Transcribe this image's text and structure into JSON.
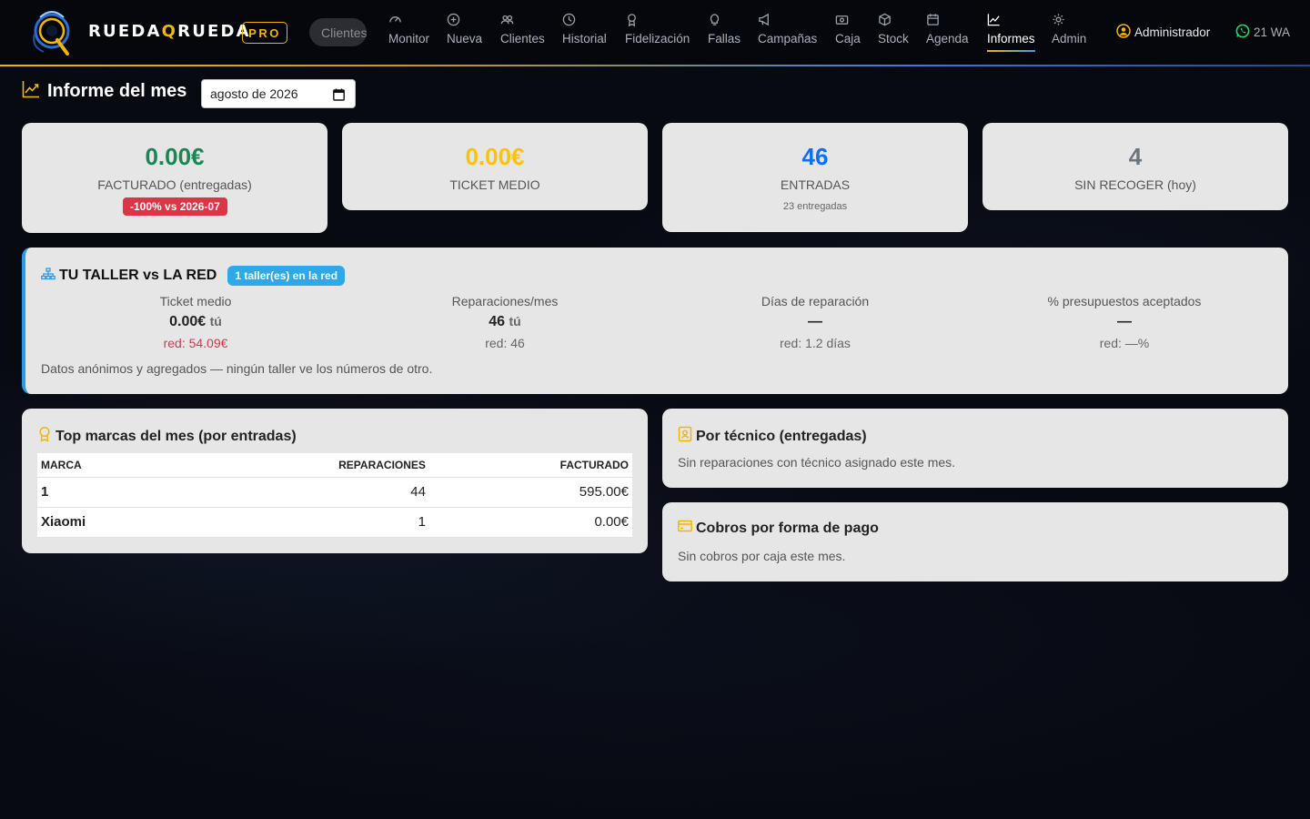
{
  "nav": {
    "brand_part1": "RUEDA",
    "brand_q": "Q",
    "brand_part2": "RUEDA",
    "pro_label": "PRO",
    "search_placeholder": "Clientes",
    "items": [
      {
        "label": "Monitor",
        "icon": "gauge-icon"
      },
      {
        "label": "Nueva",
        "icon": "plus-circle-icon"
      },
      {
        "label": "Clientes",
        "icon": "people-icon"
      },
      {
        "label": "Historial",
        "icon": "clock-icon"
      },
      {
        "label": "Fidelización",
        "icon": "award-icon"
      },
      {
        "label": "Fallas",
        "icon": "lightbulb-icon"
      },
      {
        "label": "Campañas",
        "icon": "megaphone-icon"
      },
      {
        "label": "Caja",
        "icon": "cash-icon"
      },
      {
        "label": "Stock",
        "icon": "box-icon"
      },
      {
        "label": "Agenda",
        "icon": "calendar-icon"
      },
      {
        "label": "Informes",
        "icon": "chart-icon",
        "active": true
      },
      {
        "label": "Admin",
        "icon": "gear-icon"
      }
    ],
    "user_label": "Administrador",
    "wa_label": "21 WA"
  },
  "page": {
    "title": "Informe del mes",
    "month_value": "agosto de 2026"
  },
  "stats": {
    "facturado": {
      "value": "0.00€",
      "label": "FACTURADO (entregadas)",
      "badge": "-100% vs 2026-07",
      "color": "#198754"
    },
    "ticket": {
      "value": "0.00€",
      "label": "TICKET MEDIO",
      "color": "#ffc107"
    },
    "entradas": {
      "value": "46",
      "label": "ENTRADAS",
      "sub": "23 entregadas",
      "color": "#0d6efd"
    },
    "sin_recoger": {
      "value": "4",
      "label": "SIN RECOGER (hoy)",
      "color": "#6c757d"
    }
  },
  "network": {
    "title": "TU TALLER vs LA RED",
    "badge": "1 taller(es) en la red",
    "you_suffix": "tú",
    "metrics": [
      {
        "label": "Ticket medio",
        "you": "0.00€",
        "red": "red: 54.09€",
        "bad": true
      },
      {
        "label": "Reparaciones/mes",
        "you": "46",
        "red": "red: 46",
        "bad": false
      },
      {
        "label": "Días de reparación",
        "you": "—",
        "red": "red: 1.2 días",
        "bad": false
      },
      {
        "label": "% presupuestos aceptados",
        "you": "—",
        "red": "red: —%",
        "bad": false
      }
    ],
    "footer": "Datos anónimos y agregados — ningún taller ve los números de otro."
  },
  "brands": {
    "title": "Top marcas del mes (por entradas)",
    "columns": [
      "MARCA",
      "REPARACIONES",
      "FACTURADO"
    ],
    "rows": [
      [
        "1",
        "44",
        "595.00€"
      ],
      [
        "Xiaomi",
        "1",
        "0.00€"
      ]
    ]
  },
  "tecnico": {
    "title": "Por técnico (entregadas)",
    "empty": "Sin reparaciones con técnico asignado este mes."
  },
  "cobros": {
    "title": "Cobros por forma de pago",
    "empty": "Sin cobros por caja este mes."
  }
}
